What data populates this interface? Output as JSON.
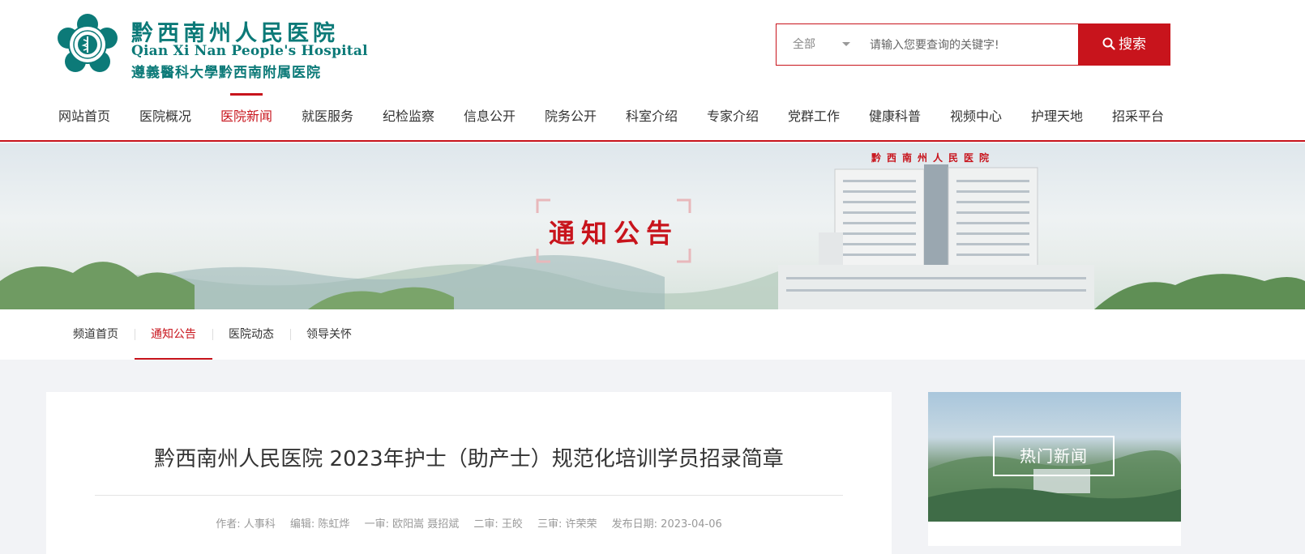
{
  "brand": {
    "name_cn": "黔西南州人民医院",
    "name_en": "Qian Xi Nan People's Hospital",
    "affiliation": "遵義醫科大學黔西南附属医院",
    "color": "#0c7a78"
  },
  "search": {
    "scope": "全部",
    "placeholder": "请输入您要查询的关键字!",
    "button": "搜索",
    "accent": "#c8141c"
  },
  "nav": {
    "items": [
      "网站首页",
      "医院概况",
      "医院新闻",
      "就医服务",
      "纪检监察",
      "信息公开",
      "院务公开",
      "科室介绍",
      "专家介绍",
      "党群工作",
      "健康科普",
      "视频中心",
      "护理天地",
      "招采平台"
    ],
    "active": "医院新闻"
  },
  "banner": {
    "title": "通知公告",
    "building_sign": "黔西南州人民医院"
  },
  "subnav": {
    "items": [
      "频道首页",
      "通知公告",
      "医院动态",
      "领导关怀"
    ],
    "active": "通知公告"
  },
  "article": {
    "title": "黔西南州人民医院 2023年护士（助产士）规范化培训学员招录简章",
    "meta": {
      "author": "作者: 人事科",
      "editor": "编辑: 陈虹烨",
      "review1": "一审: 欧阳嵩 聂招斌",
      "review2": "二审: 王皎",
      "review3": "三审: 许荣荣",
      "date": "发布日期: 2023-04-06"
    }
  },
  "sidebar": {
    "hot_news_title": "热门新闻"
  }
}
